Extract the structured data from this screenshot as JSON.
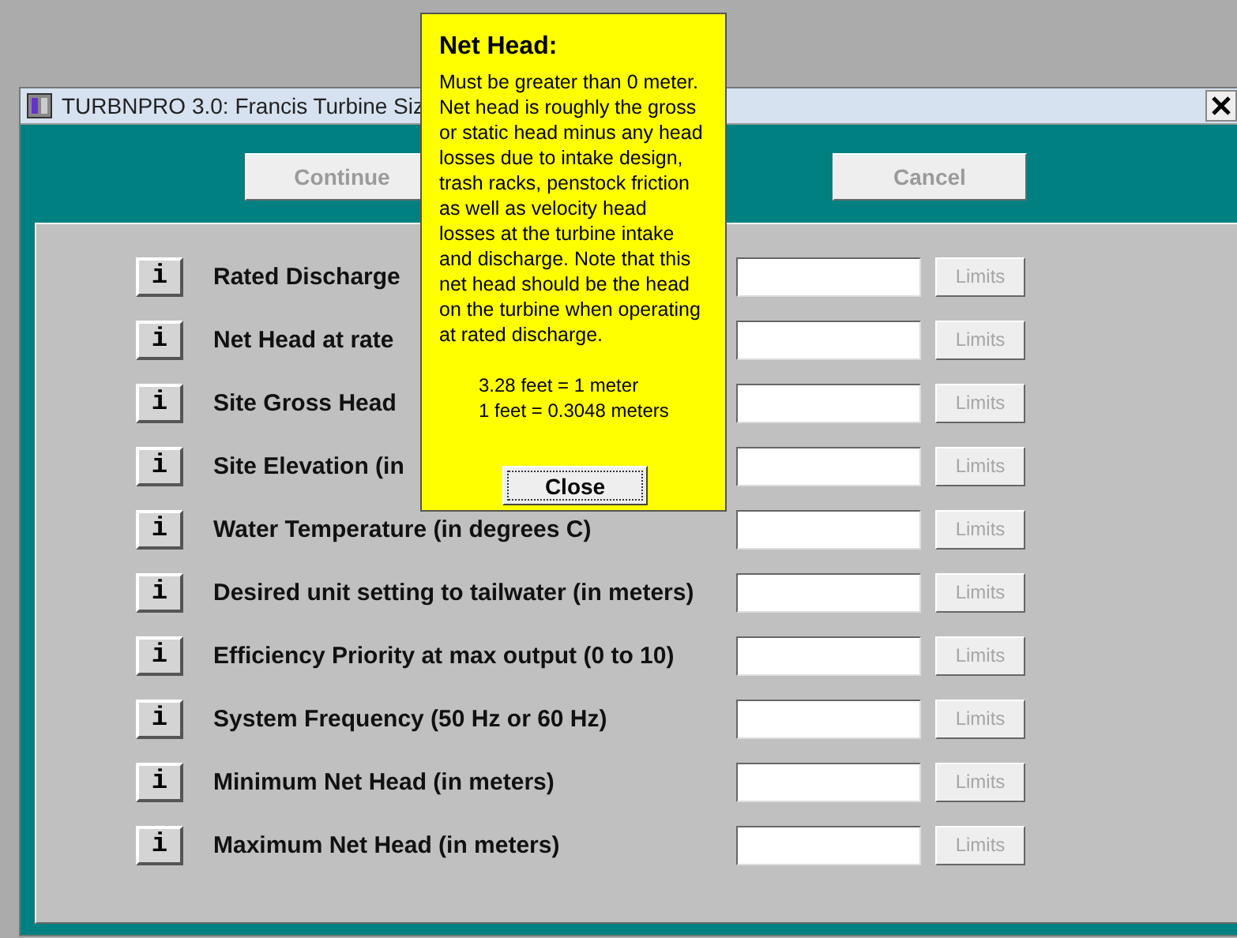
{
  "window": {
    "title": "TURBNPRO 3.0: Francis Turbine Siz"
  },
  "buttons": [
    {
      "label": "Continue",
      "disabled": true
    },
    {
      "label": "Cancel",
      "disabled": true
    }
  ],
  "rows": [
    {
      "info": "i",
      "label": "Rated Discharge",
      "value": "",
      "limits": {
        "label": "Limits",
        "disabled": true
      }
    },
    {
      "info": "i",
      "label": "Net Head at rate",
      "value": "",
      "limits": {
        "label": "Limits",
        "disabled": true
      }
    },
    {
      "info": "i",
      "label": "Site Gross Head",
      "value": "",
      "limits": {
        "label": "Limits",
        "disabled": true
      }
    },
    {
      "info": "i",
      "label": "Site Elevation (in",
      "value": "",
      "limits": {
        "label": "Limits",
        "disabled": true
      }
    },
    {
      "info": "i",
      "label": "Water Temperature (in degrees C)",
      "value": "",
      "limits": {
        "label": "Limits",
        "disabled": true
      }
    },
    {
      "info": "i",
      "label": "Desired unit setting to tailwater (in meters)",
      "value": "",
      "limits": {
        "label": "Limits",
        "disabled": true
      }
    },
    {
      "info": "i",
      "label": "Efficiency Priority at max output (0 to 10)",
      "value": "",
      "limits": {
        "label": "Limits",
        "disabled": true
      }
    },
    {
      "info": "i",
      "label": "System Frequency (50 Hz or 60 Hz)",
      "value": "",
      "limits": {
        "label": "Limits",
        "disabled": true
      }
    },
    {
      "info": "i",
      "label": "Minimum Net Head (in meters)",
      "value": "",
      "limits": {
        "label": "Limits",
        "disabled": true
      }
    },
    {
      "info": "i",
      "label": "Maximum Net Head (in meters)",
      "value": "",
      "limits": {
        "label": "Limits",
        "disabled": true
      }
    }
  ],
  "help_popup": {
    "title": "Net Head:",
    "body": "Must be greater than 0 meter. Net head is roughly the gross or static head minus any head losses due to intake design, trash racks, penstock friction as well as velocity head losses at the turbine intake and discharge. Note that this net head should be the head on the turbine when operating at rated discharge.",
    "conversions": [
      "3.28 feet = 1 meter",
      "1 feet = 0.3048 meters"
    ],
    "close_button": "Close"
  }
}
